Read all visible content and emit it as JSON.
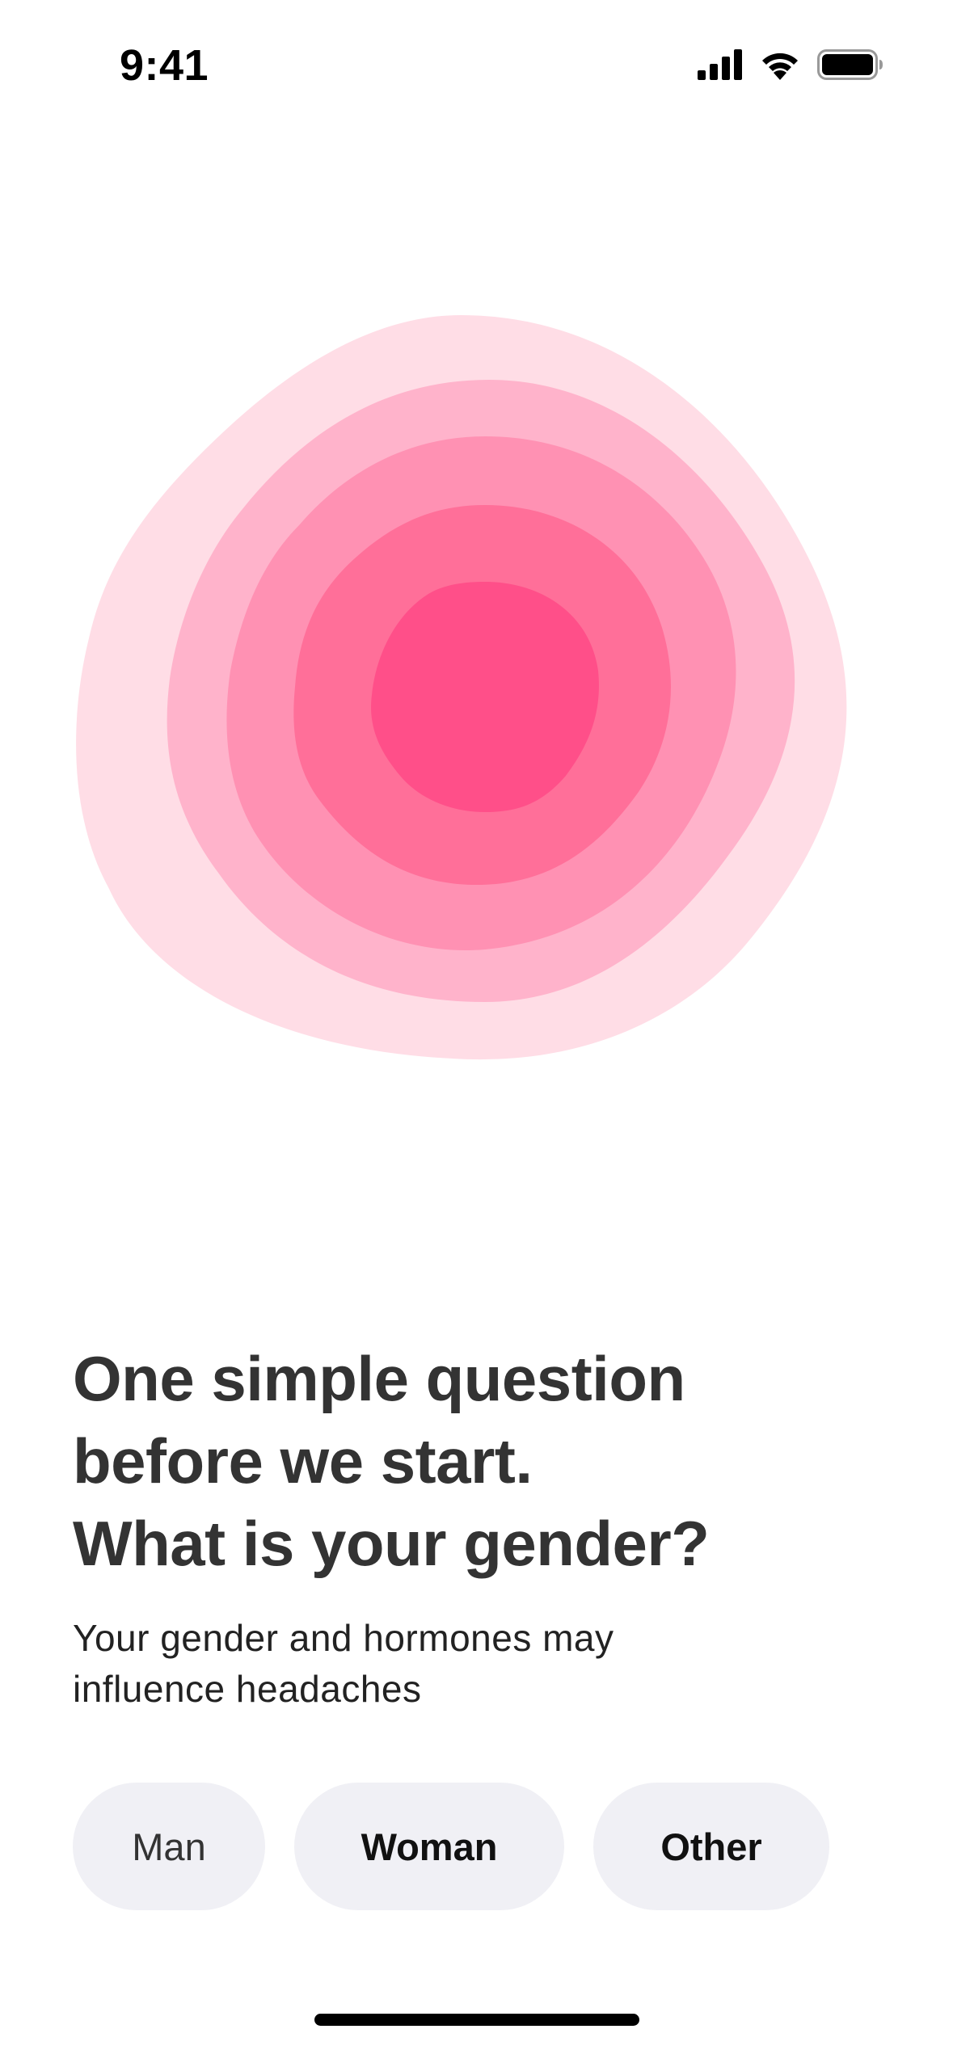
{
  "status_bar": {
    "time": "9:41",
    "icons": [
      "cellular-signal-icon",
      "wifi-icon",
      "battery-icon"
    ]
  },
  "illustration": {
    "name": "concentric-pink-blob",
    "colors": [
      "#ffdde6",
      "#ffb3cb",
      "#ff91b3",
      "#ff6f99",
      "#ff4f89"
    ]
  },
  "question": {
    "heading_lines": [
      "One simple question",
      "before we start.",
      "What is your gender?"
    ],
    "subtitle_lines": [
      "Your gender and hormones may",
      "influence headaches"
    ]
  },
  "options": [
    {
      "label": "Man"
    },
    {
      "label": "Woman"
    },
    {
      "label": "Other"
    }
  ],
  "colors": {
    "text": "#333333",
    "option_background": "#f0f0f5",
    "accent": "#ff4f89"
  }
}
